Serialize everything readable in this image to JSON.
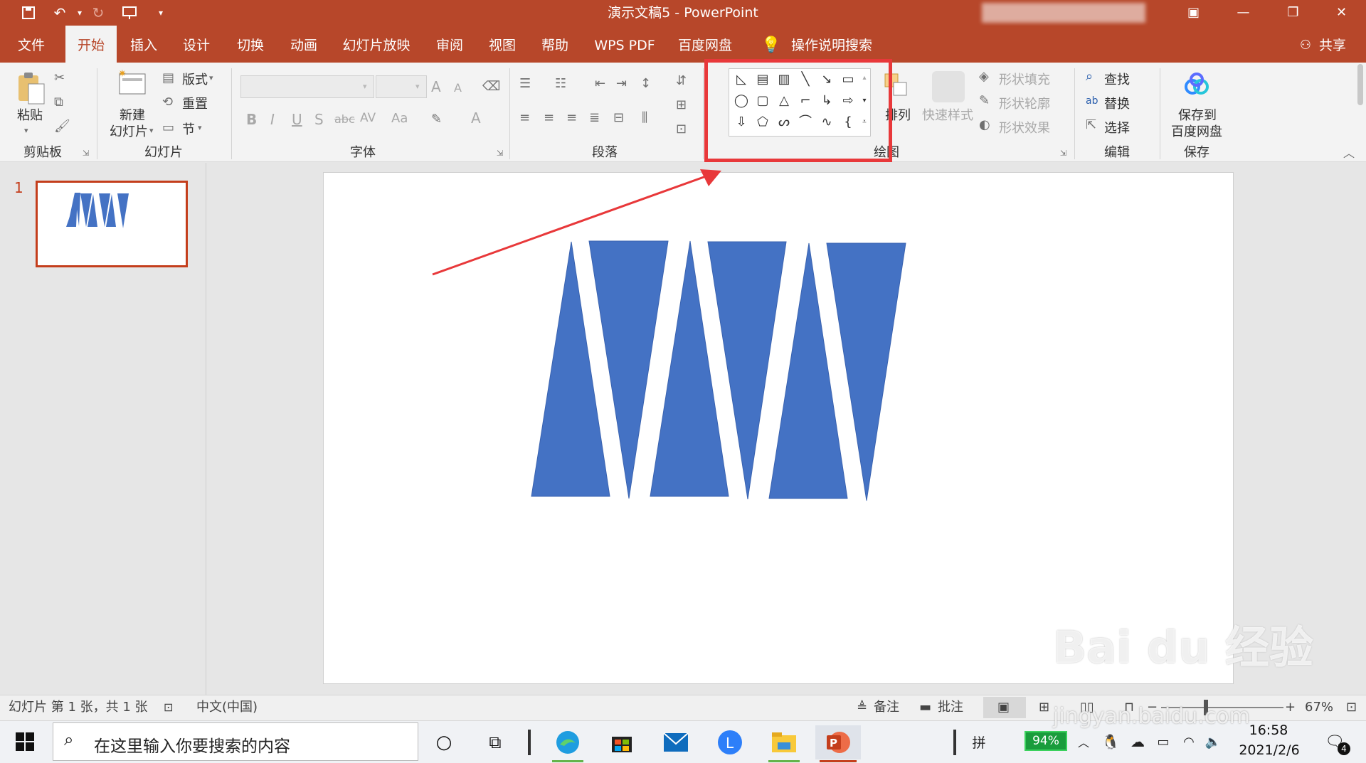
{
  "window": {
    "title": "演示文稿5 - PowerPoint"
  },
  "tabs": [
    "文件",
    "开始",
    "插入",
    "设计",
    "切换",
    "动画",
    "幻灯片放映",
    "审阅",
    "视图",
    "帮助",
    "WPS PDF",
    "百度网盘"
  ],
  "search_tell": "操作说明搜索",
  "share": "共享",
  "ribbon": {
    "clipboard": {
      "paste": "粘贴",
      "group": "剪贴板"
    },
    "slides": {
      "new_line1": "新建",
      "new_line2": "幻灯片",
      "layout": "版式",
      "reset": "重置",
      "section": "节",
      "group": "幻灯片"
    },
    "font": {
      "group": "字体",
      "bold": "B",
      "italic": "I",
      "underline": "U",
      "shadow": "S",
      "strike": "abc",
      "spacing": "AV",
      "case": "Aa",
      "grow": "A",
      "shrink": "A",
      "color": "A"
    },
    "paragraph": {
      "group": "段落"
    },
    "drawing": {
      "arrange": "排列",
      "quick_styles": "快速样式",
      "fill": "形状填充",
      "outline": "形状轮廓",
      "effects": "形状效果",
      "group": "绘图"
    },
    "editing": {
      "find": "查找",
      "replace": "替换",
      "select": "选择",
      "group": "编辑"
    },
    "save": {
      "line1": "保存到",
      "line2": "百度网盘",
      "group": "保存"
    }
  },
  "thumbnail": {
    "number": "1"
  },
  "status": {
    "slide_info": "幻灯片 第 1 张，共 1 张",
    "language": "中文(中国)",
    "notes": "备注",
    "comments": "批注",
    "zoom": "67%"
  },
  "taskbar": {
    "search_placeholder": "在这里输入你要搜索的内容",
    "battery": "94%",
    "ime": "拼",
    "time": "16:58",
    "date": "2021/2/6",
    "notif_count": "4"
  },
  "watermark": {
    "brand": "Bai du 经验",
    "url": "jingyan.baidu.com"
  },
  "colors": {
    "accent": "#b7472a",
    "shape_fill": "#4472c4",
    "annotation": "#e8383a"
  }
}
